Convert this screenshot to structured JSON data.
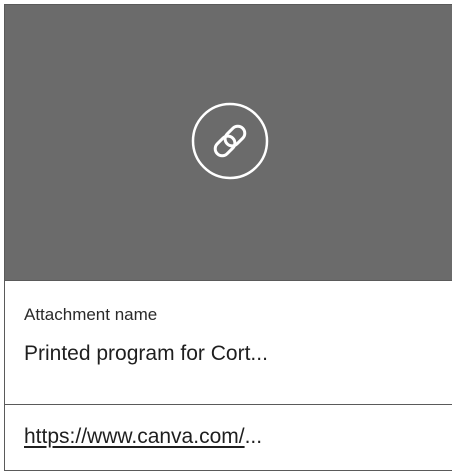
{
  "attachment": {
    "type_icon": "link-icon",
    "name_label": "Attachment name",
    "name_value": "Printed program for Cort...",
    "url_text": "https://www.canva.com/",
    "url_ellipsis": "..."
  },
  "colors": {
    "preview_background": "#6b6b6b",
    "icon_stroke": "#ffffff",
    "border": "#5a5a5a",
    "text": "#1f1f1f"
  }
}
